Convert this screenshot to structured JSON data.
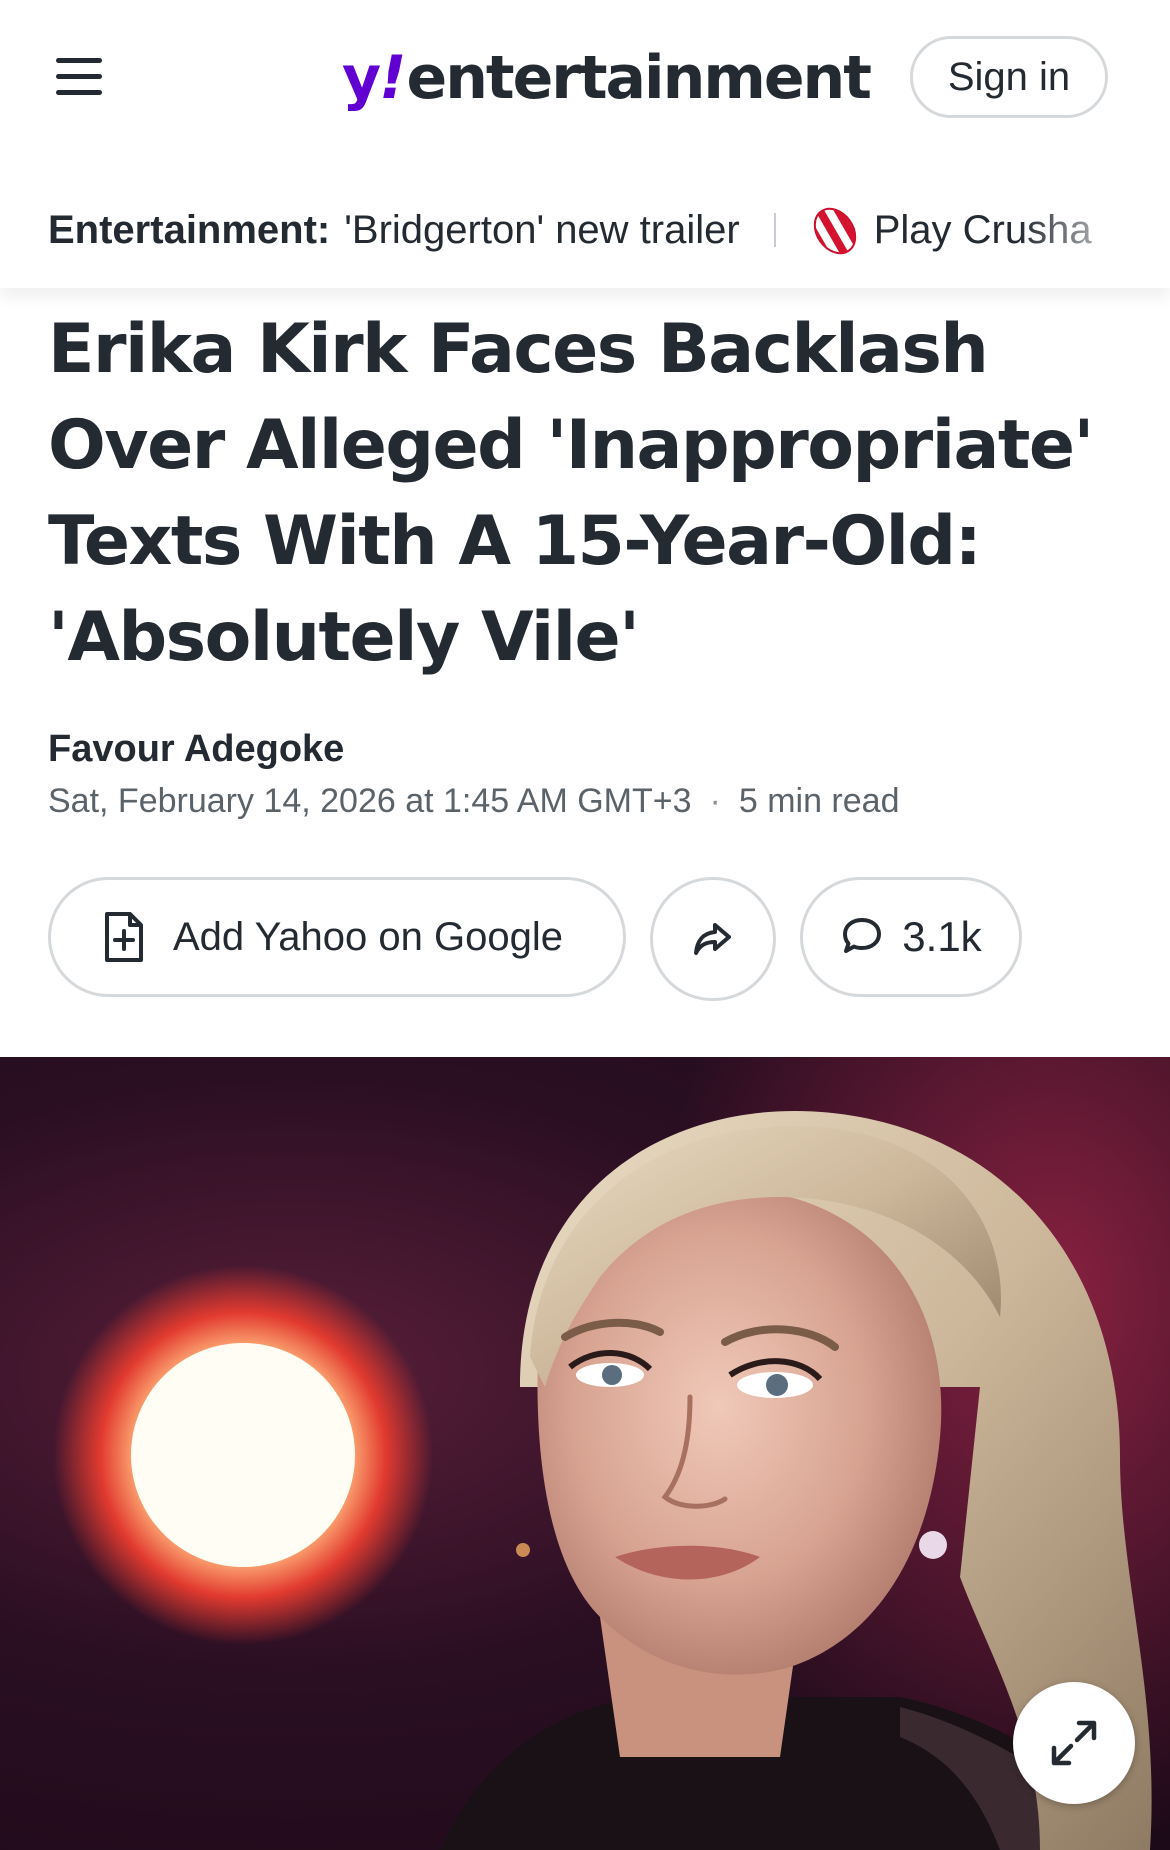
{
  "header": {
    "logo": {
      "y": "y",
      "bang": "!",
      "word": "entertainment"
    },
    "sign_in_label": "Sign in"
  },
  "trending": {
    "label": "Entertainment:",
    "items": [
      {
        "text": "'Bridgerton' new trailer"
      },
      {
        "text": "Play Crusha",
        "icon": "candy-icon"
      }
    ]
  },
  "article": {
    "headline": "Erika Kirk Faces Backlash Over Alleged 'Inappropriate' Texts With A 15-Year-Old: 'Absolutely Vile'",
    "author": "Favour Adegoke",
    "date": "Sat, February 14, 2026 at 1:45 AM GMT+3",
    "separator": "·",
    "read_time": "5 min read"
  },
  "actions": {
    "google_label": "Add Yahoo on Google",
    "share_icon": "share-arrow-icon",
    "comment_icon": "comment-bubble-icon",
    "comment_count": "3.1k"
  },
  "hero": {
    "expand_icon": "expand-arrows-icon"
  },
  "colors": {
    "brand_purple": "#6001d2",
    "text_primary": "#232a31",
    "text_secondary": "#5b636a",
    "border": "#d6d9dc"
  }
}
